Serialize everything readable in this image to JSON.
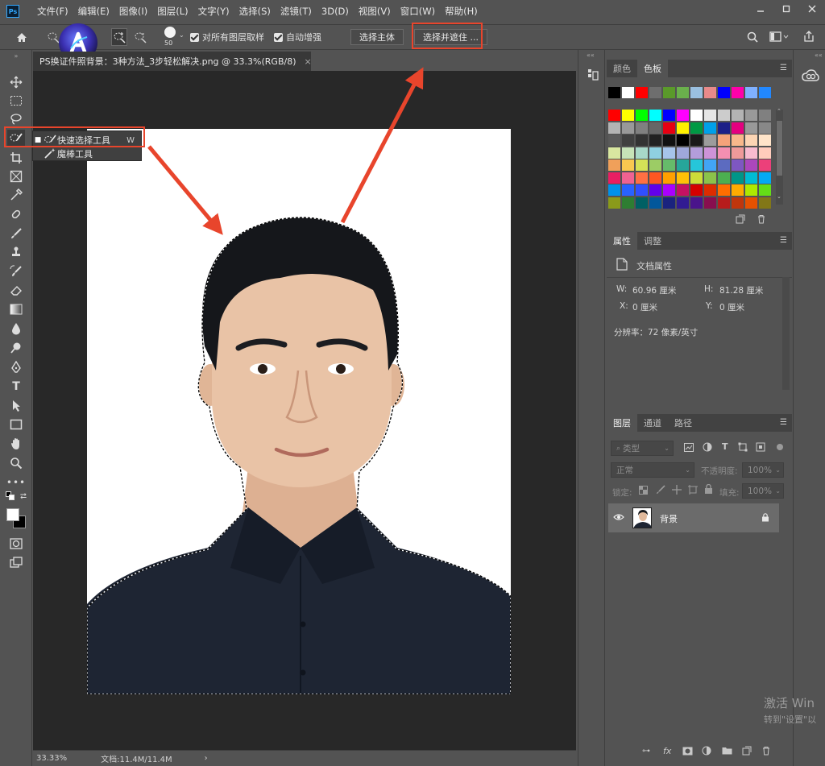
{
  "app": {
    "logo": "Ps",
    "menu": [
      "文件(F)",
      "编辑(E)",
      "图像(I)",
      "图层(L)",
      "文字(Y)",
      "选择(S)",
      "滤镜(T)",
      "3D(D)",
      "视图(V)",
      "窗口(W)",
      "帮助(H)"
    ]
  },
  "options": {
    "brush_size": "50",
    "sample_all_layers": "对所有图层取样",
    "auto_enhance": "自动增强",
    "select_subject": "选择主体",
    "select_and_mask": "选择并遮住 ..."
  },
  "document": {
    "tab_title": "PS换证件照背景：3种方法_3步轻松解决.png @ 33.3%(RGB/8)",
    "close": "×"
  },
  "flyout": {
    "items": [
      {
        "label": "快速选择工具",
        "key": "W",
        "icon": "quick-selection-icon"
      },
      {
        "label": "魔棒工具",
        "key": "",
        "icon": "magic-wand-icon"
      }
    ]
  },
  "status": {
    "zoom": "33.33%",
    "doc_size": "文档:11.4M/11.4M",
    "arrow": "›"
  },
  "swatches_panel": {
    "tabs": [
      "颜色",
      "色板"
    ],
    "active": 1,
    "recent_colors": [
      "#000000",
      "#ffffff",
      "#ff0000",
      "#6e6e6e",
      "#5a9a2a",
      "#6ab04c",
      "#9ac0e0",
      "#e88a8a",
      "#0000ff",
      "#ff00aa",
      "#7fb0ff",
      "#2288ff"
    ],
    "grid_colors": [
      "#ff0000",
      "#ffff00",
      "#00ff00",
      "#00ffff",
      "#0000ff",
      "#ff00ff",
      "#ffffff",
      "#e6e6e6",
      "#cccccc",
      "#b3b3b3",
      "#999999",
      "#808080",
      "#b3b3b3",
      "#999999",
      "#808080",
      "#666666",
      "#e60012",
      "#fff100",
      "#009944",
      "#00a0e9",
      "#1d2088",
      "#e4007f",
      "#999999",
      "#888888",
      "#5a5a5a",
      "#404040",
      "#333333",
      "#222222",
      "#111111",
      "#000000",
      "#1a1a1a",
      "#9c9c9c",
      "#f5a27a",
      "#f8b88b",
      "#fcd5b4",
      "#ffe4c9",
      "#d9e7a0",
      "#c7e3b8",
      "#a8d8c8",
      "#8fd0e0",
      "#a6c4ea",
      "#9fa8da",
      "#b39ddb",
      "#ce93d8",
      "#f48fb1",
      "#ef9a9a",
      "#f8bbd0",
      "#ffccbc",
      "#f0a05a",
      "#f8c850",
      "#d4e157",
      "#9ccc65",
      "#66bb6a",
      "#26a69a",
      "#26c6da",
      "#42a5f5",
      "#5c6bc0",
      "#7e57c2",
      "#ab47bc",
      "#ec407a",
      "#e91e63",
      "#f06292",
      "#ff7043",
      "#ff5722",
      "#ffa000",
      "#ffc107",
      "#cddc39",
      "#8bc34a",
      "#4caf50",
      "#009688",
      "#00bcd4",
      "#03a9f4",
      "#0091ea",
      "#2962ff",
      "#304ffe",
      "#6200ea",
      "#aa00ff",
      "#c51162",
      "#d50000",
      "#dd2c00",
      "#ff6d00",
      "#ffab00",
      "#aeea00",
      "#64dd17",
      "#8a9a1a",
      "#2e7d32",
      "#006064",
      "#01579b",
      "#1a237e",
      "#311b92",
      "#4a148c",
      "#880e4f",
      "#b71c1c",
      "#bf360c",
      "#e65100",
      "#827717"
    ]
  },
  "properties_panel": {
    "tabs": [
      "属性",
      "调整"
    ],
    "active": 0,
    "title": "文档属性",
    "w_label": "W:",
    "w_value": "60.96 厘米",
    "h_label": "H:",
    "h_value": "81.28 厘米",
    "x_label": "X:",
    "x_value": "0 厘米",
    "y_label": "Y:",
    "y_value": "0 厘米",
    "resolution": "分辨率：72 像素/英寸"
  },
  "layers_panel": {
    "tabs": [
      "图层",
      "通道",
      "路径"
    ],
    "active": 0,
    "filter_placeholder": "类型",
    "blend_mode": "正常",
    "opacity_label": "不透明度:",
    "opacity_value": "100%",
    "lock_label": "锁定:",
    "fill_label": "填充:",
    "fill_value": "100%",
    "layer_name": "背景",
    "bottom_fx": "fx"
  },
  "watermark": {
    "line1": "激活 Win",
    "line2": "转到\"设置\"以"
  },
  "colors": {
    "accent_red": "#e8452c",
    "canvas_bg": "#282828",
    "ui_bg": "#535353",
    "shirt": "#1e2533",
    "hair": "#15171b",
    "skin": "#e9c3a6"
  }
}
